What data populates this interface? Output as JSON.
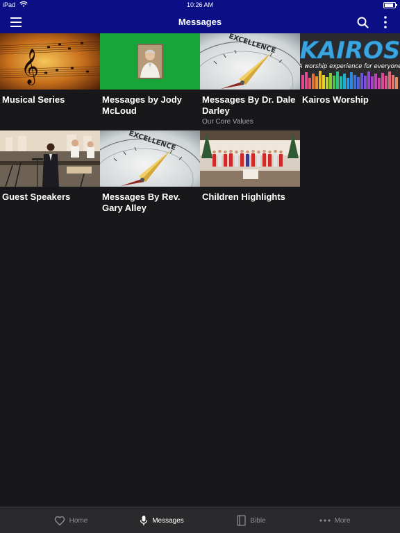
{
  "status": {
    "device": "iPad",
    "time": "10:26 AM"
  },
  "header": {
    "title": "Messages"
  },
  "tiles": [
    {
      "title": "Musical Series",
      "subtitle": ""
    },
    {
      "title": "Messages by Jody McLoud",
      "subtitle": ""
    },
    {
      "title": "Messages By Dr. Dale Darley",
      "subtitle": "Our Core Values"
    },
    {
      "title": "Kairos Worship",
      "subtitle": "",
      "logo_text": "KAIROS",
      "logo_tagline": "A worship experience for everyone"
    },
    {
      "title": "Guest Speakers",
      "subtitle": ""
    },
    {
      "title": "Messages By Rev. Gary Alley",
      "subtitle": ""
    },
    {
      "title": "Children Highlights",
      "subtitle": ""
    }
  ],
  "thumb_text": {
    "excellence": "EXCELLENCE"
  },
  "tabs": [
    {
      "label": "Home",
      "icon": "heart-icon"
    },
    {
      "label": "Messages",
      "icon": "microphone-icon"
    },
    {
      "label": "Bible",
      "icon": "book-icon"
    },
    {
      "label": "More",
      "icon": "ellipsis-icon"
    }
  ],
  "colors": {
    "nav": "#0a0f85",
    "background": "#18181a",
    "tabbar": "#2a2a2c"
  }
}
